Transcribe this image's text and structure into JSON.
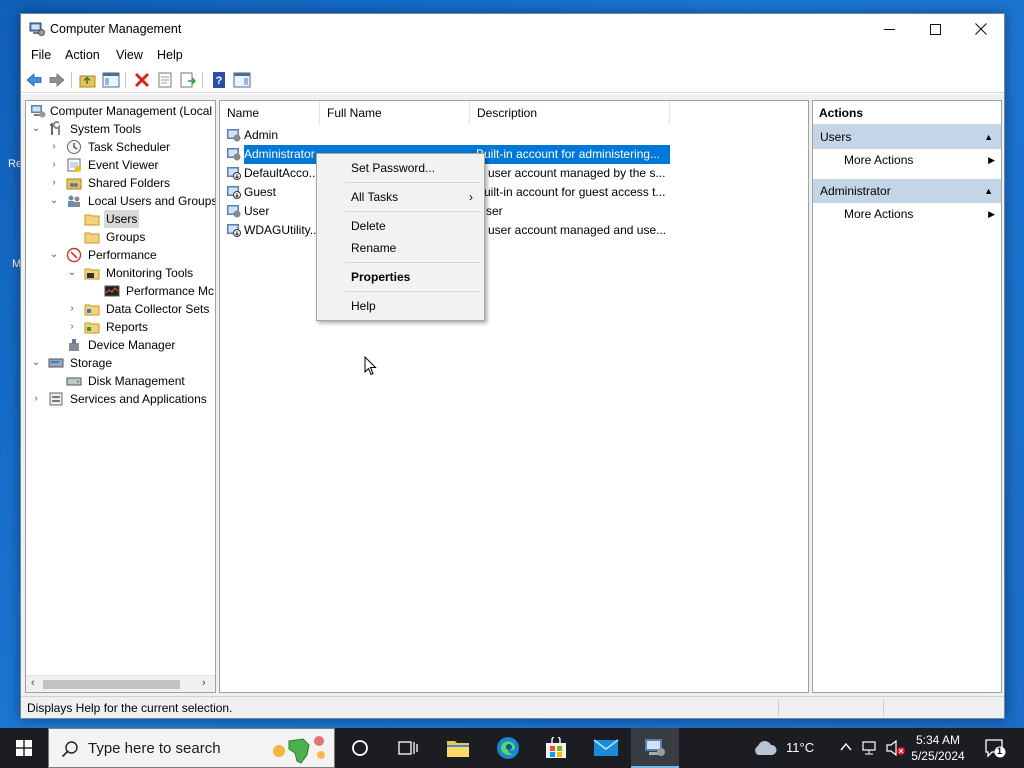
{
  "window": {
    "title": "Computer Management",
    "controls": {
      "minimize": "—",
      "maximize": "☐",
      "close": "✕"
    }
  },
  "menubar": [
    "File",
    "Action",
    "View",
    "Help"
  ],
  "tree": {
    "root": "Computer Management (Local",
    "system_tools": "System Tools",
    "task_scheduler": "Task Scheduler",
    "event_viewer": "Event Viewer",
    "shared_folders": "Shared Folders",
    "local_users_groups": "Local Users and Groups",
    "users": "Users",
    "groups": "Groups",
    "performance": "Performance",
    "monitoring_tools": "Monitoring Tools",
    "performance_monitor": "Performance Mc",
    "data_collector_sets": "Data Collector Sets",
    "reports": "Reports",
    "device_manager": "Device Manager",
    "storage": "Storage",
    "disk_management": "Disk Management",
    "services_apps": "Services and Applications"
  },
  "list": {
    "columns": [
      "Name",
      "Full Name",
      "Description"
    ],
    "rows": [
      {
        "name": "Admin",
        "full_name": "",
        "description": ""
      },
      {
        "name": "Administrator",
        "full_name": "",
        "description": "Built-in account for administering..."
      },
      {
        "name": "DefaultAcco...",
        "full_name": "",
        "description": "A user account managed by the s..."
      },
      {
        "name": "Guest",
        "full_name": "",
        "description": "Built-in account for guest access t..."
      },
      {
        "name": "User",
        "full_name": "",
        "description": "User"
      },
      {
        "name": "WDAGUtility...",
        "full_name": "",
        "description": "A user account managed and use..."
      }
    ],
    "visible_descriptions": [
      "Built-in account for administering...",
      "user account managed by the s...",
      "uilt-in account for guest access t...",
      "ser",
      "user account managed and use..."
    ]
  },
  "context_menu": {
    "set_password": "Set Password...",
    "all_tasks": "All Tasks",
    "delete": "Delete",
    "rename": "Rename",
    "properties": "Properties",
    "help": "Help",
    "submenu_arrow": "›"
  },
  "actions": {
    "header": "Actions",
    "section1": "Users",
    "section1_item": "More Actions",
    "section2": "Administrator",
    "section2_item": "More Actions"
  },
  "statusbar": {
    "text": "Displays Help for the current selection."
  },
  "taskbar": {
    "search_placeholder": "Type here to search",
    "weather": "11°C",
    "time": "5:34 AM",
    "date": "5/25/2024",
    "notification_count": "1"
  },
  "desktop": {
    "left_glyphs": [
      "Re",
      "M"
    ]
  },
  "colors": {
    "selection": "#0078d7",
    "action_section": "#c5d5e8",
    "taskbar": "#1c1d22",
    "desktop": "#1b78d4"
  }
}
